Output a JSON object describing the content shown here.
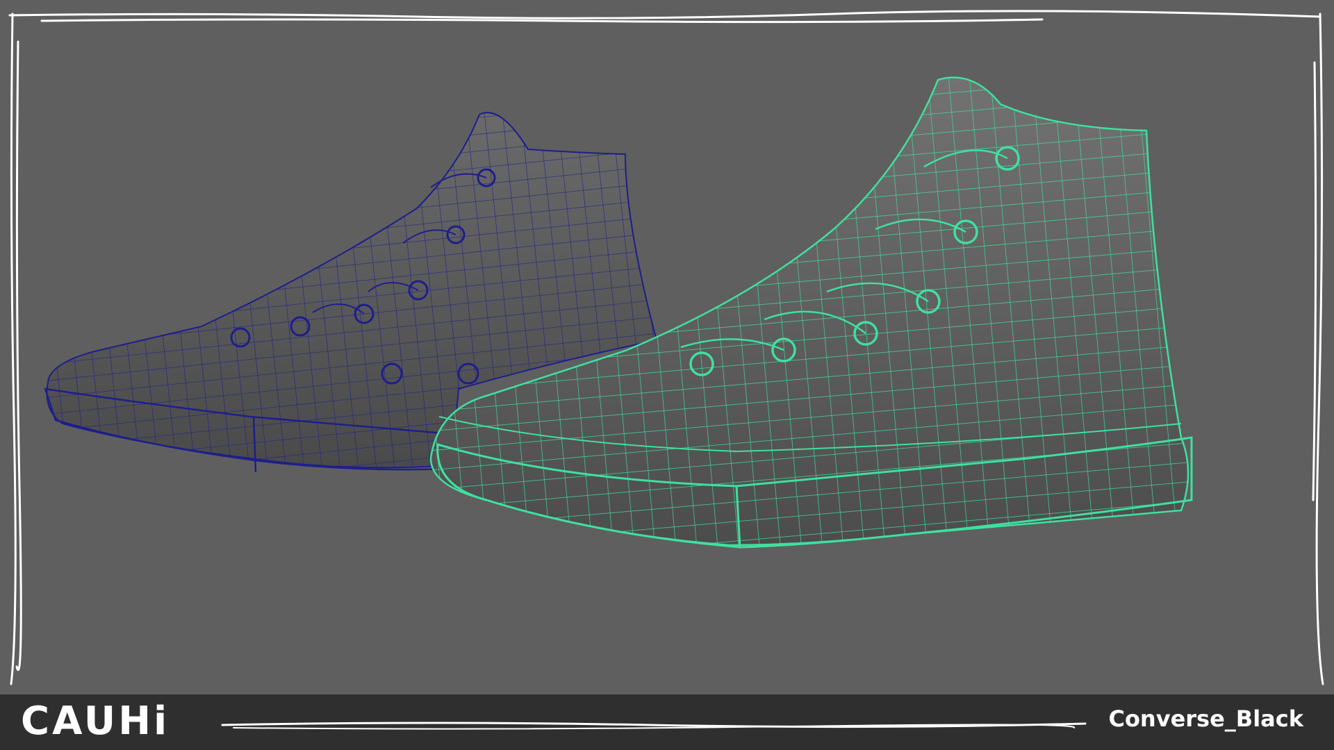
{
  "brand": {
    "logo_text": "CAUHi"
  },
  "asset": {
    "name": "Converse_Black"
  },
  "viewport": {
    "background_color": "#5f5f5f",
    "frame_color": "#ffffff",
    "objects": [
      {
        "label": "shoe-left",
        "wireframe_color": "#1e1e8c"
      },
      {
        "label": "shoe-right-selected",
        "wireframe_color": "#3fe0a0"
      }
    ]
  },
  "bottom_bar": {
    "background_color": "#2f2f2f"
  }
}
